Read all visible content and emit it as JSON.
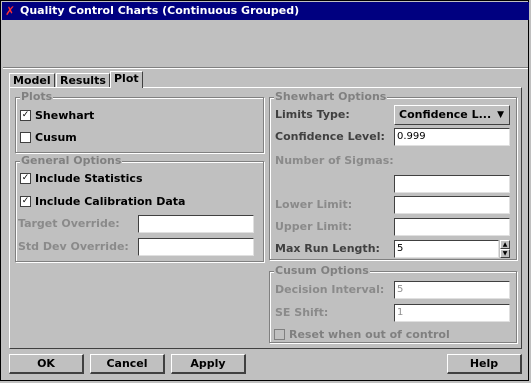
{
  "window": {
    "title": "Quality Control Charts (Continuous Grouped)",
    "title_bg": "#000080"
  },
  "tabs": [
    {
      "label": "Model",
      "active": false
    },
    {
      "label": "Results",
      "active": false
    },
    {
      "label": "Plot",
      "active": true
    }
  ],
  "plots": {
    "title": "Plots",
    "shewhart": {
      "label": "Shewhart",
      "checked": true
    },
    "cusum": {
      "label": "Cusum",
      "checked": false
    }
  },
  "general_options": {
    "title": "General Options",
    "include_statistics": {
      "label": "Include Statistics",
      "checked": true
    },
    "include_calibration": {
      "label": "Include Calibration Data",
      "checked": true
    },
    "target_override": {
      "label": "Target Override:",
      "value": ""
    },
    "std_dev_override": {
      "label": "Std Dev Override:",
      "value": ""
    }
  },
  "shewhart_options": {
    "title": "Shewhart Options",
    "limits_type": {
      "label": "Limits Type:",
      "value": "Confidence L..."
    },
    "confidence_level": {
      "label": "Confidence Level:",
      "value": "0.999"
    },
    "number_of_sigmas": {
      "label": "Number of Sigmas:",
      "value": ""
    },
    "lower_limit": {
      "label": "Lower Limit:",
      "value": ""
    },
    "upper_limit": {
      "label": "Upper Limit:",
      "value": ""
    },
    "max_run_length": {
      "label": "Max Run Length:",
      "value": "5"
    }
  },
  "cusum_options": {
    "title": "Cusum Options",
    "decision_interval": {
      "label": "Decision Interval:",
      "value": "5"
    },
    "se_shift": {
      "label": "SE Shift:",
      "value": "1"
    },
    "reset": {
      "label": "Reset when out of control",
      "checked": false
    }
  },
  "buttons": {
    "ok": "OK",
    "cancel": "Cancel",
    "apply": "Apply",
    "help": "Help"
  }
}
